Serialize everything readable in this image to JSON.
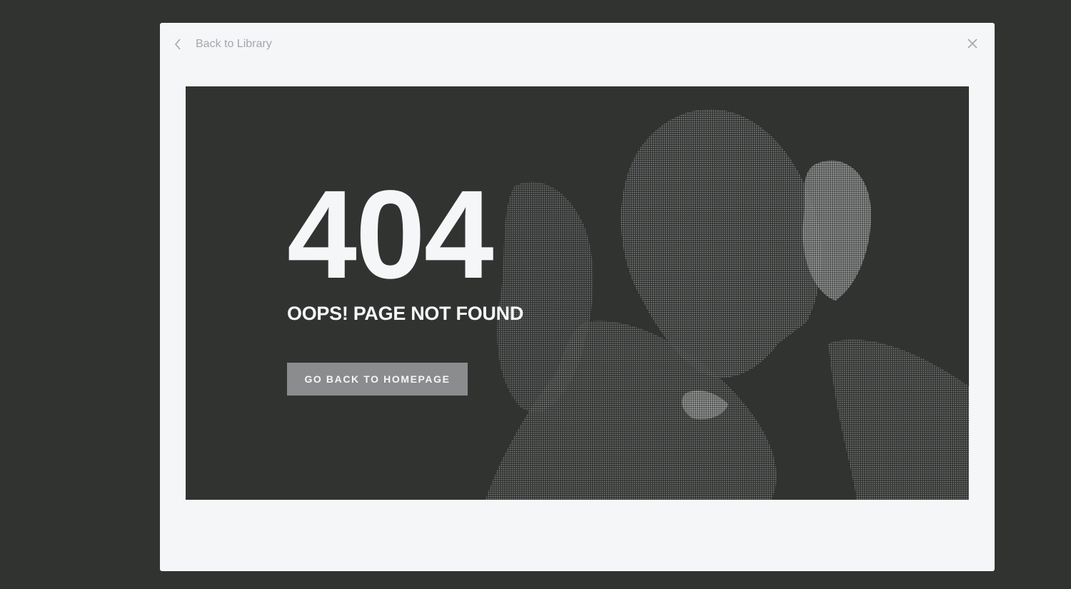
{
  "header": {
    "back_label": "Back to Library",
    "back_icon": "chevron-left-icon",
    "close_icon": "close-icon"
  },
  "preview": {
    "error_code": "404",
    "error_message": "OOPS! PAGE NOT FOUND",
    "button_label": "GO BACK TO HOMEPAGE"
  },
  "colors": {
    "backdrop": "#313331",
    "modal_background": "#f5f6f8",
    "text_light": "#f5f6f8",
    "muted": "#a3a6ab",
    "button_background": "#8a8c8e"
  }
}
